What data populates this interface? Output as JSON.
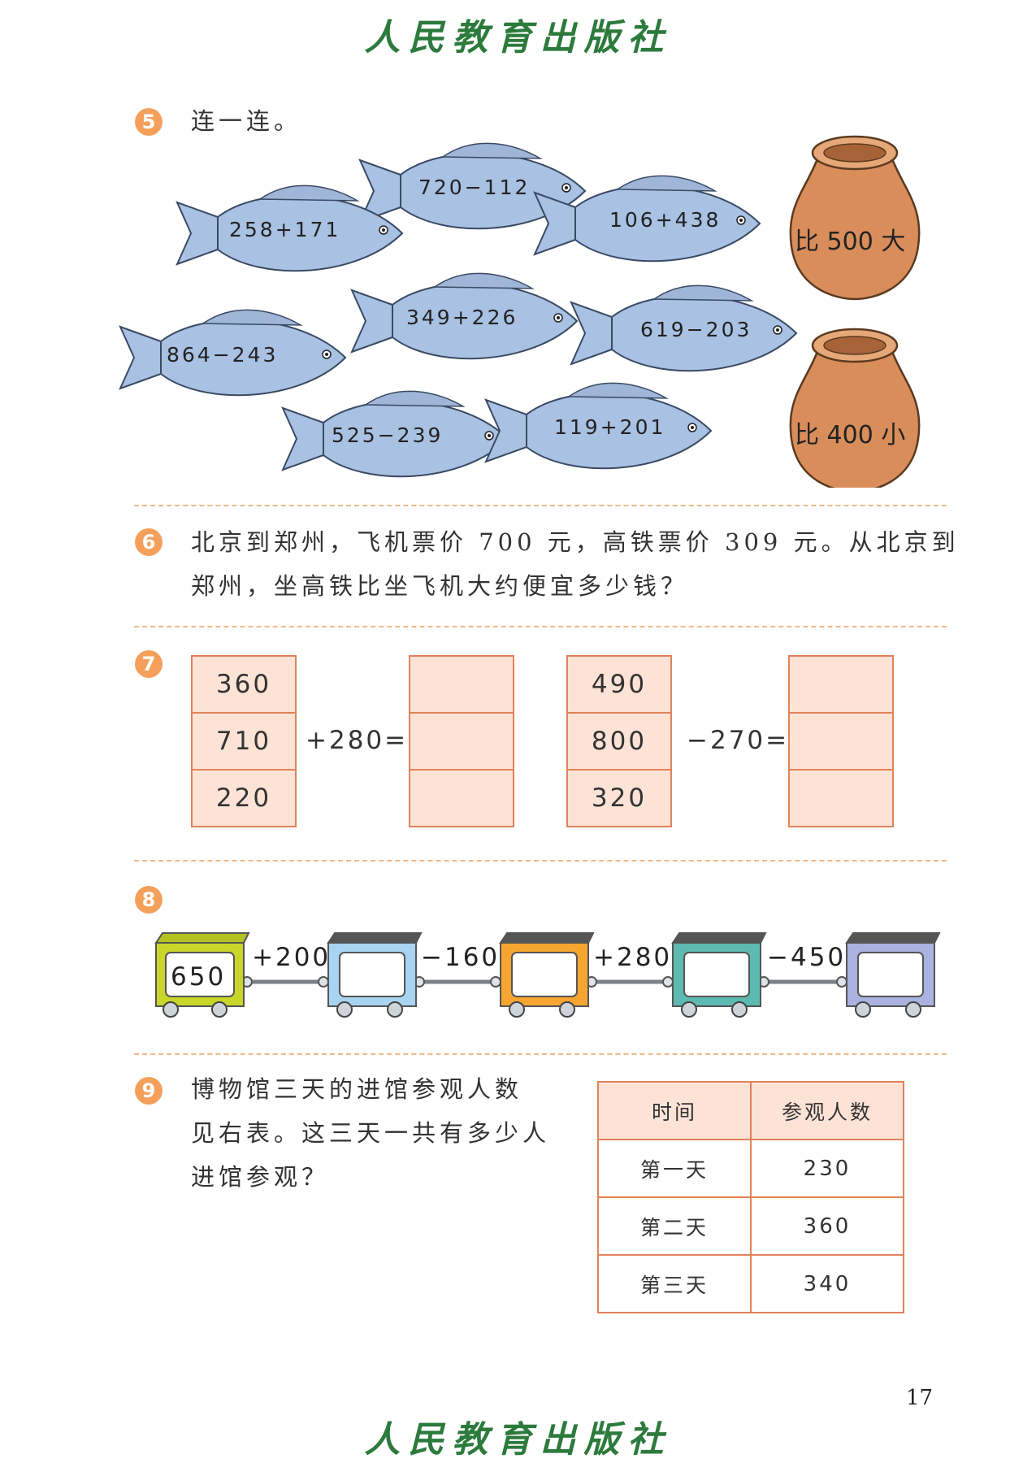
{
  "publisher": "人民教育出版社",
  "page_number": "17",
  "q5": {
    "number": "5",
    "prompt": "连一连。",
    "fish": [
      "720−112",
      "258+171",
      "106+438",
      "349+226",
      "864−243",
      "619−203",
      "525−239",
      "119+201"
    ],
    "pots": [
      "比 500 大",
      "比 400 小"
    ]
  },
  "q6": {
    "number": "6",
    "line1": "北京到郑州，飞机票价 700 元，高铁票价 309 元。从北京到",
    "line2": "郑州，坐高铁比坐飞机大约便宜多少钱？"
  },
  "q7": {
    "number": "7",
    "left_values": [
      "360",
      "710",
      "220"
    ],
    "left_op": "+280=",
    "right_values": [
      "490",
      "800",
      "320"
    ],
    "right_op": "−270="
  },
  "q8": {
    "number": "8",
    "start_value": "650",
    "ops": [
      "+200",
      "−160",
      "+280",
      "−450"
    ]
  },
  "q9": {
    "number": "9",
    "line1": "博物馆三天的进馆参观人数",
    "line2": "见右表。这三天一共有多少人",
    "line3": "进馆参观？",
    "table": {
      "headers": [
        "时间",
        "参观人数"
      ],
      "rows": [
        {
          "label": "第一天",
          "value": "230"
        },
        {
          "label": "第二天",
          "value": "360"
        },
        {
          "label": "第三天",
          "value": "340"
        }
      ]
    }
  }
}
